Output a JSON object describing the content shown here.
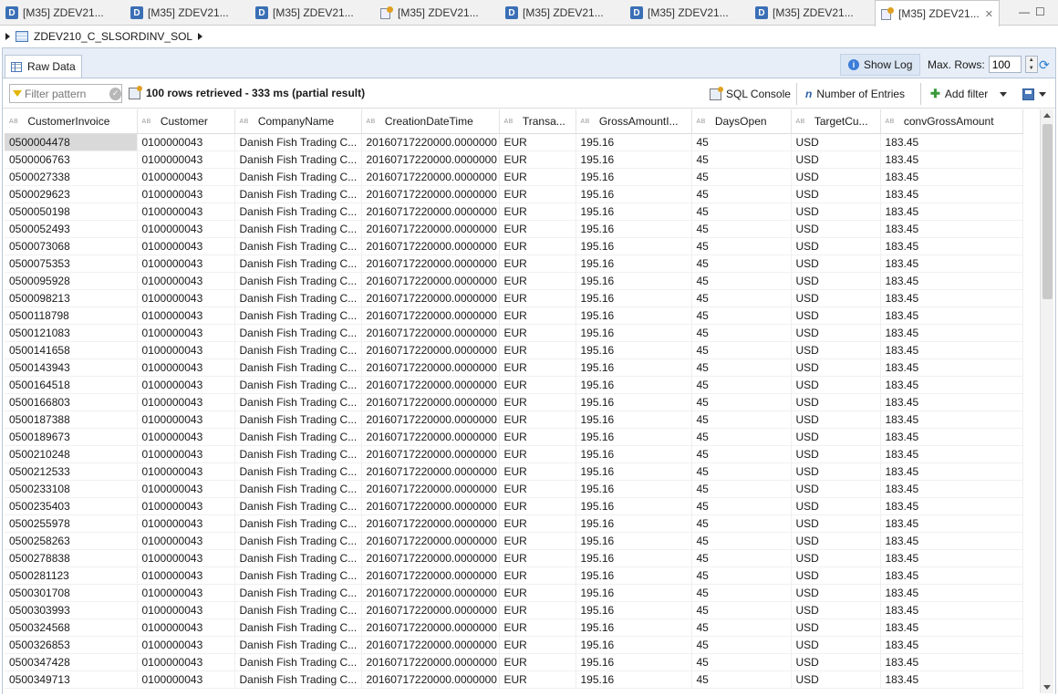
{
  "editor_tabs": [
    {
      "label": "[M35] ZDEV21...",
      "icon": "ddl-icon",
      "active": false
    },
    {
      "label": "[M35] ZDEV21...",
      "icon": "ddl-icon",
      "active": false
    },
    {
      "label": "[M35] ZDEV21...",
      "icon": "ddl-icon",
      "active": false
    },
    {
      "label": "[M35] ZDEV21...",
      "icon": "data-preview-icon",
      "active": false
    },
    {
      "label": "[M35] ZDEV21...",
      "icon": "ddl-icon",
      "active": false
    },
    {
      "label": "[M35] ZDEV21...",
      "icon": "ddl-icon",
      "active": false
    },
    {
      "label": "[M35] ZDEV21...",
      "icon": "ddl-icon",
      "active": false
    },
    {
      "label": "[M35] ZDEV21...",
      "icon": "data-preview-icon",
      "active": true
    }
  ],
  "tab_close": "✕",
  "window_controls": {
    "minimize": "—",
    "maximize": "☐"
  },
  "breadcrumb": {
    "entity": "ZDEV210_C_SLSORDINV_SOL"
  },
  "subtab": {
    "label": "Raw Data"
  },
  "show_log": {
    "label": "Show Log"
  },
  "max_rows": {
    "label": "Max. Rows:",
    "value": "100"
  },
  "filter": {
    "placeholder": "Filter pattern"
  },
  "status_text": "100 rows retrieved - 333 ms (partial result)",
  "toolbar": {
    "sql_console": "SQL Console",
    "number_of_entries": "Number of Entries",
    "add_filter": "Add filter"
  },
  "columns": [
    "CustomerInvoice",
    "Customer",
    "CompanyName",
    "CreationDateTime",
    "Transa...",
    "GrossAmountI...",
    "DaysOpen",
    "TargetCu...",
    "convGrossAmount"
  ],
  "column_type_badge": "AB",
  "rows": [
    [
      "0500004478",
      "0100000043",
      "Danish Fish Trading C...",
      "20160717220000.0000000",
      "EUR",
      "195.16",
      "45",
      "USD",
      "183.45"
    ],
    [
      "0500006763",
      "0100000043",
      "Danish Fish Trading C...",
      "20160717220000.0000000",
      "EUR",
      "195.16",
      "45",
      "USD",
      "183.45"
    ],
    [
      "0500027338",
      "0100000043",
      "Danish Fish Trading C...",
      "20160717220000.0000000",
      "EUR",
      "195.16",
      "45",
      "USD",
      "183.45"
    ],
    [
      "0500029623",
      "0100000043",
      "Danish Fish Trading C...",
      "20160717220000.0000000",
      "EUR",
      "195.16",
      "45",
      "USD",
      "183.45"
    ],
    [
      "0500050198",
      "0100000043",
      "Danish Fish Trading C...",
      "20160717220000.0000000",
      "EUR",
      "195.16",
      "45",
      "USD",
      "183.45"
    ],
    [
      "0500052493",
      "0100000043",
      "Danish Fish Trading C...",
      "20160717220000.0000000",
      "EUR",
      "195.16",
      "45",
      "USD",
      "183.45"
    ],
    [
      "0500073068",
      "0100000043",
      "Danish Fish Trading C...",
      "20160717220000.0000000",
      "EUR",
      "195.16",
      "45",
      "USD",
      "183.45"
    ],
    [
      "0500075353",
      "0100000043",
      "Danish Fish Trading C...",
      "20160717220000.0000000",
      "EUR",
      "195.16",
      "45",
      "USD",
      "183.45"
    ],
    [
      "0500095928",
      "0100000043",
      "Danish Fish Trading C...",
      "20160717220000.0000000",
      "EUR",
      "195.16",
      "45",
      "USD",
      "183.45"
    ],
    [
      "0500098213",
      "0100000043",
      "Danish Fish Trading C...",
      "20160717220000.0000000",
      "EUR",
      "195.16",
      "45",
      "USD",
      "183.45"
    ],
    [
      "0500118798",
      "0100000043",
      "Danish Fish Trading C...",
      "20160717220000.0000000",
      "EUR",
      "195.16",
      "45",
      "USD",
      "183.45"
    ],
    [
      "0500121083",
      "0100000043",
      "Danish Fish Trading C...",
      "20160717220000.0000000",
      "EUR",
      "195.16",
      "45",
      "USD",
      "183.45"
    ],
    [
      "0500141658",
      "0100000043",
      "Danish Fish Trading C...",
      "20160717220000.0000000",
      "EUR",
      "195.16",
      "45",
      "USD",
      "183.45"
    ],
    [
      "0500143943",
      "0100000043",
      "Danish Fish Trading C...",
      "20160717220000.0000000",
      "EUR",
      "195.16",
      "45",
      "USD",
      "183.45"
    ],
    [
      "0500164518",
      "0100000043",
      "Danish Fish Trading C...",
      "20160717220000.0000000",
      "EUR",
      "195.16",
      "45",
      "USD",
      "183.45"
    ],
    [
      "0500166803",
      "0100000043",
      "Danish Fish Trading C...",
      "20160717220000.0000000",
      "EUR",
      "195.16",
      "45",
      "USD",
      "183.45"
    ],
    [
      "0500187388",
      "0100000043",
      "Danish Fish Trading C...",
      "20160717220000.0000000",
      "EUR",
      "195.16",
      "45",
      "USD",
      "183.45"
    ],
    [
      "0500189673",
      "0100000043",
      "Danish Fish Trading C...",
      "20160717220000.0000000",
      "EUR",
      "195.16",
      "45",
      "USD",
      "183.45"
    ],
    [
      "0500210248",
      "0100000043",
      "Danish Fish Trading C...",
      "20160717220000.0000000",
      "EUR",
      "195.16",
      "45",
      "USD",
      "183.45"
    ],
    [
      "0500212533",
      "0100000043",
      "Danish Fish Trading C...",
      "20160717220000.0000000",
      "EUR",
      "195.16",
      "45",
      "USD",
      "183.45"
    ],
    [
      "0500233108",
      "0100000043",
      "Danish Fish Trading C...",
      "20160717220000.0000000",
      "EUR",
      "195.16",
      "45",
      "USD",
      "183.45"
    ],
    [
      "0500235403",
      "0100000043",
      "Danish Fish Trading C...",
      "20160717220000.0000000",
      "EUR",
      "195.16",
      "45",
      "USD",
      "183.45"
    ],
    [
      "0500255978",
      "0100000043",
      "Danish Fish Trading C...",
      "20160717220000.0000000",
      "EUR",
      "195.16",
      "45",
      "USD",
      "183.45"
    ],
    [
      "0500258263",
      "0100000043",
      "Danish Fish Trading C...",
      "20160717220000.0000000",
      "EUR",
      "195.16",
      "45",
      "USD",
      "183.45"
    ],
    [
      "0500278838",
      "0100000043",
      "Danish Fish Trading C...",
      "20160717220000.0000000",
      "EUR",
      "195.16",
      "45",
      "USD",
      "183.45"
    ],
    [
      "0500281123",
      "0100000043",
      "Danish Fish Trading C...",
      "20160717220000.0000000",
      "EUR",
      "195.16",
      "45",
      "USD",
      "183.45"
    ],
    [
      "0500301708",
      "0100000043",
      "Danish Fish Trading C...",
      "20160717220000.0000000",
      "EUR",
      "195.16",
      "45",
      "USD",
      "183.45"
    ],
    [
      "0500303993",
      "0100000043",
      "Danish Fish Trading C...",
      "20160717220000.0000000",
      "EUR",
      "195.16",
      "45",
      "USD",
      "183.45"
    ],
    [
      "0500324568",
      "0100000043",
      "Danish Fish Trading C...",
      "20160717220000.0000000",
      "EUR",
      "195.16",
      "45",
      "USD",
      "183.45"
    ],
    [
      "0500326853",
      "0100000043",
      "Danish Fish Trading C...",
      "20160717220000.0000000",
      "EUR",
      "195.16",
      "45",
      "USD",
      "183.45"
    ],
    [
      "0500347428",
      "0100000043",
      "Danish Fish Trading C...",
      "20160717220000.0000000",
      "EUR",
      "195.16",
      "45",
      "USD",
      "183.45"
    ],
    [
      "0500349713",
      "0100000043",
      "Danish Fish Trading C...",
      "20160717220000.0000000",
      "EUR",
      "195.16",
      "45",
      "USD",
      "183.45"
    ]
  ],
  "colors": {
    "panel_bg": "#e7eef8",
    "show_log_bg": "#dbe6f4",
    "selected_cell": "#d9d9d9",
    "accent": "#3b7dd8"
  }
}
